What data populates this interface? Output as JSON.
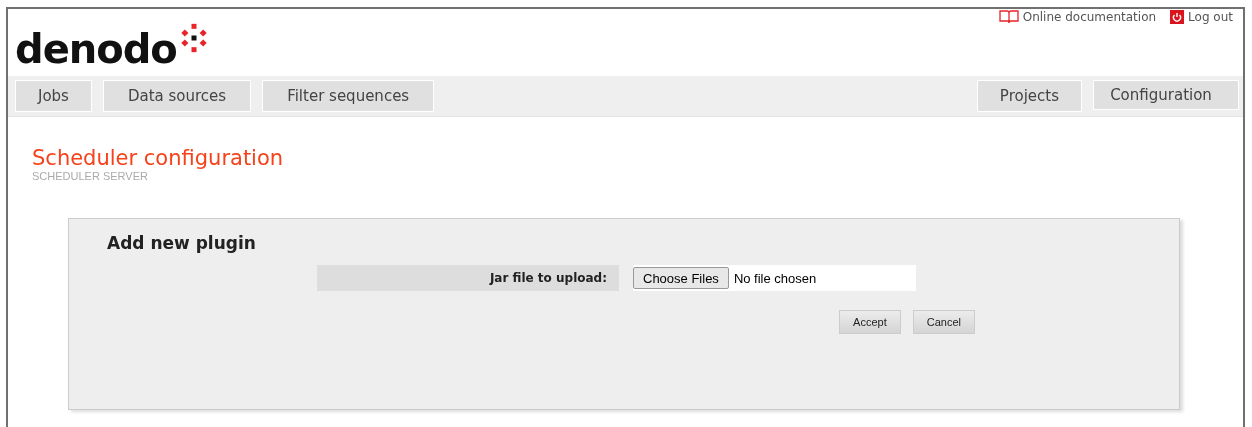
{
  "header": {
    "logo": "denodo",
    "links": [
      {
        "kind": "docs",
        "label": "Online documentation"
      },
      {
        "kind": "logout",
        "label": "Log out"
      }
    ]
  },
  "nav": {
    "left": [
      {
        "label": "Jobs",
        "has_menu": false
      },
      {
        "label": "Data sources",
        "has_menu": false
      },
      {
        "label": "Filter sequences",
        "has_menu": false
      }
    ],
    "right": [
      {
        "label": "Projects",
        "has_menu": false
      },
      {
        "label": "Configuration",
        "has_menu": true
      }
    ]
  },
  "page": {
    "title": "Scheduler configuration",
    "subtitle": "SCHEDULER SERVER"
  },
  "panel": {
    "heading": "Add new plugin",
    "field": {
      "label": "Jar file to upload:",
      "button": "Choose Files",
      "value": "No file chosen"
    },
    "buttons": [
      "Accept",
      "Cancel"
    ]
  }
}
